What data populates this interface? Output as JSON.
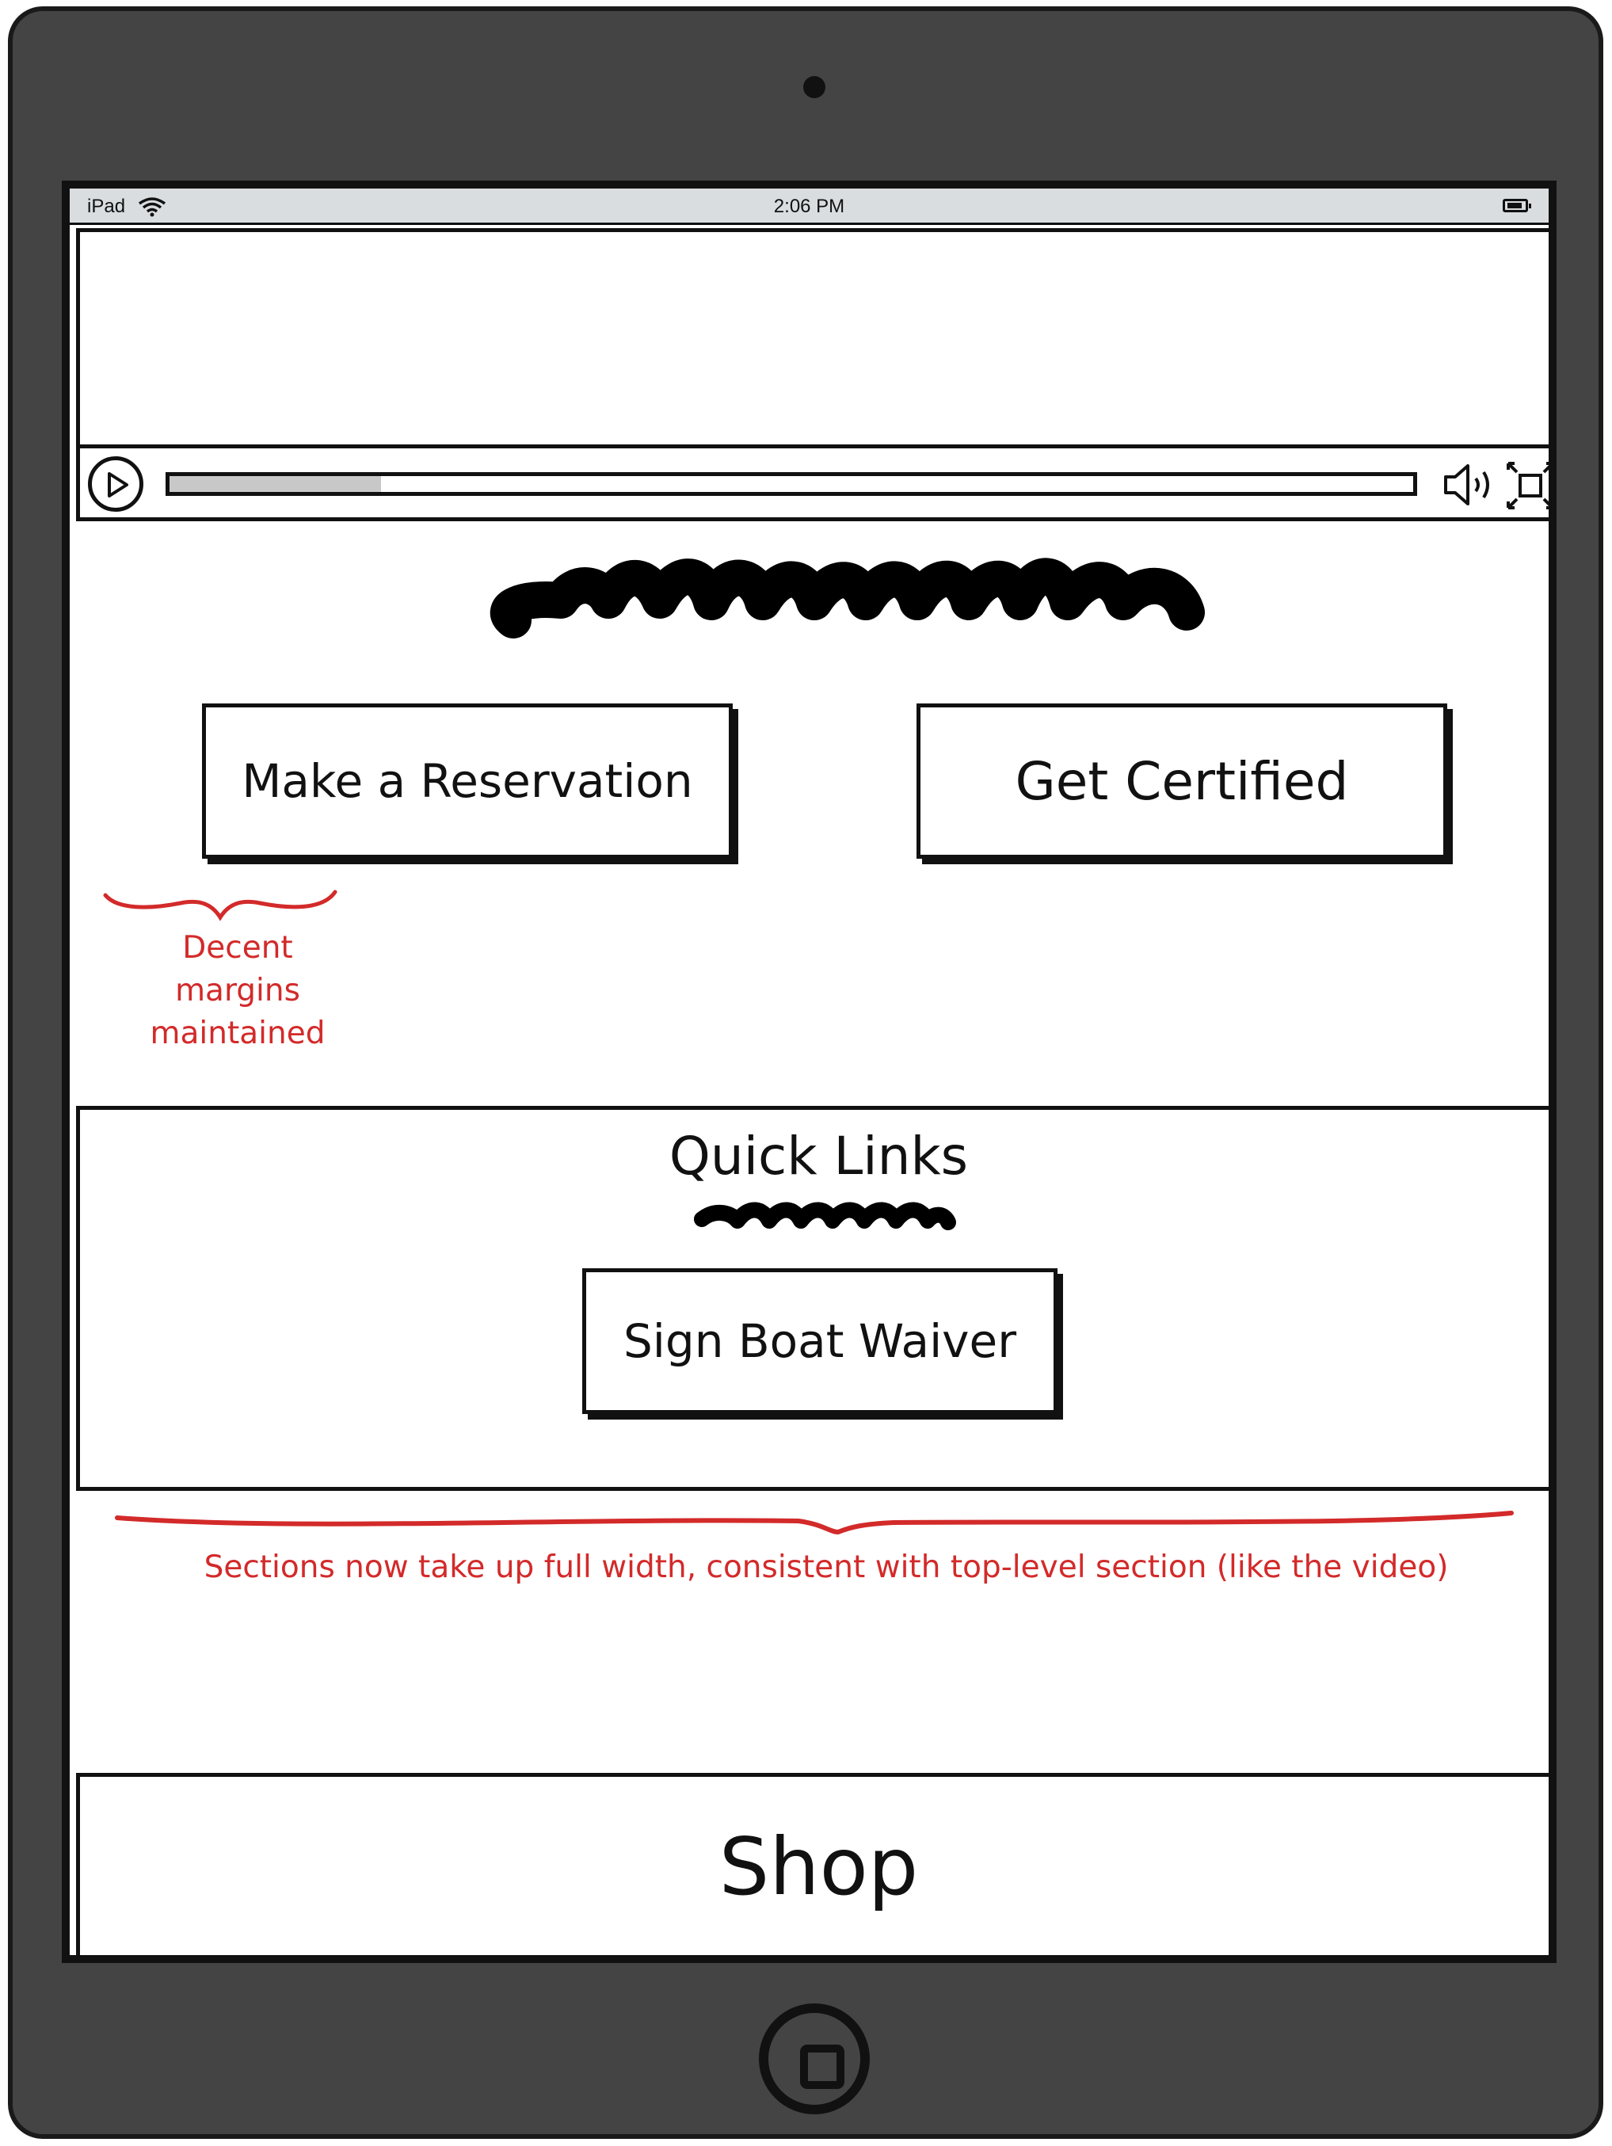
{
  "status_bar": {
    "device": "iPad",
    "time": "2:06 PM"
  },
  "video": {
    "progress_percent": 17
  },
  "hero": {
    "primary_button": "Make a Reservation",
    "secondary_button": "Get Certified"
  },
  "quick_links": {
    "title": "Quick Links",
    "waiver_button": "Sign Boat Waiver"
  },
  "footer": {
    "shop_label": "Shop"
  },
  "annotations": {
    "margin_note_lines": [
      "Decent",
      "margins",
      "maintained"
    ],
    "width_note": "Sections now take up full width, consistent with top-level section (like the video)"
  },
  "colors": {
    "annotation": "#d32a2a",
    "device_frame": "#444444",
    "status_bar": "#d9dde0"
  },
  "icons": [
    "wifi-icon",
    "battery-icon",
    "play-icon",
    "volume-icon",
    "fullscreen-icon",
    "home-button-icon"
  ]
}
